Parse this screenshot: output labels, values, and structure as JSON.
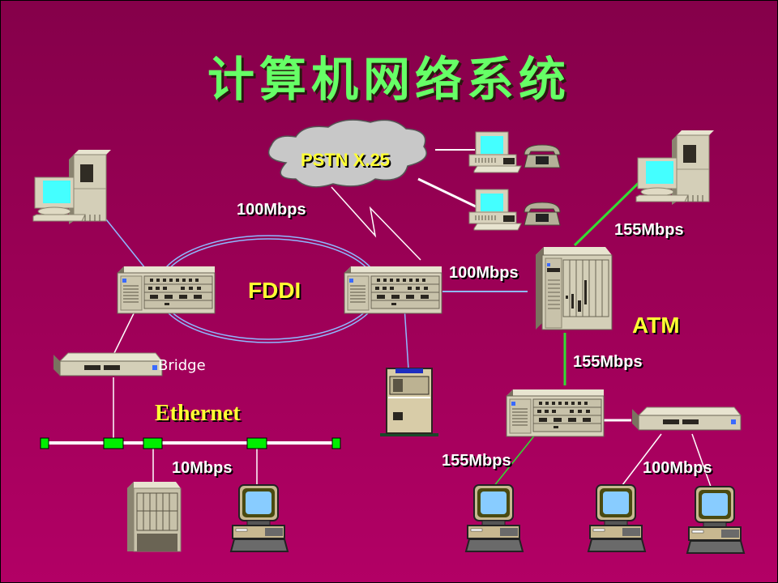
{
  "title": "计算机网络系统",
  "labels": {
    "pstn": "PSTN X.25",
    "fddi": "FDDI",
    "atm": "ATM",
    "ethernet": "Ethernet",
    "bridge": "Bridge",
    "fddi_speed": "100Mbps",
    "fddi_atm_speed": "100Mbps",
    "atm_ws_speed": "155Mbps",
    "atm_switch_speed": "155Mbps",
    "eth_speed": "10Mbps",
    "atm_pc_speed": "155Mbps",
    "hub_pc_speed": "100Mbps"
  },
  "colors": {
    "background_top": "#85004a",
    "background_bottom": "#b20065",
    "title": "#66ff66",
    "label_yellow": "#ffff33",
    "fddi_ring": "#8fb8ff",
    "atm_link": "#33dd33",
    "ethernet_node": "#00ee00"
  },
  "nodes": [
    {
      "id": "ws-top-left",
      "type": "workstation"
    },
    {
      "id": "fddi-router-left",
      "type": "router"
    },
    {
      "id": "fddi-router-right",
      "type": "router"
    },
    {
      "id": "bridge",
      "type": "bridge"
    },
    {
      "id": "mainframe",
      "type": "server"
    },
    {
      "id": "pstn-pc-1",
      "type": "pc-with-phone"
    },
    {
      "id": "pstn-pc-2",
      "type": "pc-with-phone"
    },
    {
      "id": "atm-switch",
      "type": "atm-switch"
    },
    {
      "id": "ws-top-right",
      "type": "workstation"
    },
    {
      "id": "atm-router",
      "type": "router"
    },
    {
      "id": "hub",
      "type": "hub"
    },
    {
      "id": "eth-server",
      "type": "tower-server"
    },
    {
      "id": "eth-pc",
      "type": "pc"
    },
    {
      "id": "atm-pc",
      "type": "pc"
    },
    {
      "id": "hub-pc-1",
      "type": "pc"
    },
    {
      "id": "hub-pc-2",
      "type": "pc"
    }
  ]
}
